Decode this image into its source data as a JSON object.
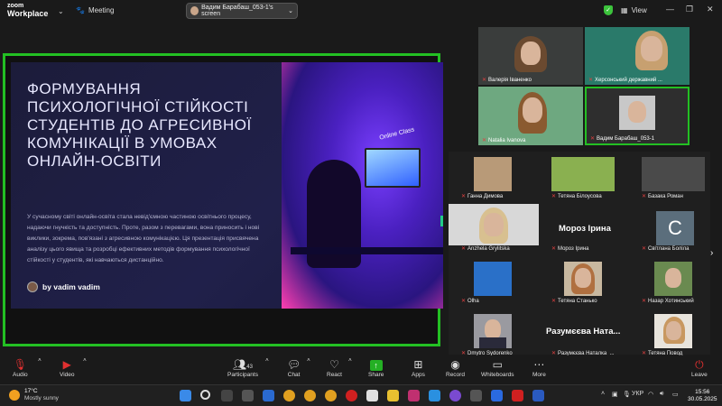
{
  "app": {
    "brand_top": "zoom",
    "brand_bottom": "Workplace",
    "meeting_label": "Meeting",
    "view_label": "View"
  },
  "share_pill": {
    "label": "Вадим Барабаш_053-1's screen"
  },
  "slide": {
    "title": "ФОРМУВАННЯ ПСИХОЛОГІЧНОЇ СТІЙКОСТІ СТУДЕНТІВ ДО АГРЕСИВНОЇ КОМУНІКАЦІЇ В УМОВАХ ОНЛАЙН-ОСВІТИ",
    "body": "У сучасному світі онлайн-освіта стала невід'ємною частиною освітнього процесу, надаючи гнучкість та доступність. Проте, разом з перевагами, вона приносить і нові виклики, зокрема, пов'язані з агресивною комунікацією. Ця презентація присвячена аналізу цього явища та розробці ефективних методів формування психологічної стійкості у студентів, які навчаються дистанційно.",
    "author": "by vadim vadim",
    "image_caption": "Online Class"
  },
  "top_tiles": [
    {
      "name": "Валерія Іваненко"
    },
    {
      "name": "Херсонський державний ..."
    },
    {
      "name": "Natalia Ivanova"
    },
    {
      "name": "Вадим Барабаш_053-1"
    }
  ],
  "bottom_tiles": [
    {
      "name": "Ганна Димова"
    },
    {
      "name": "Тетяна Білоусова"
    },
    {
      "name": "Базака Роман"
    },
    {
      "name": "Anzhela Grylitska"
    },
    {
      "name": "Мороз Ірина",
      "big": "Мороз Ірина"
    },
    {
      "name": "Світлана Болілa",
      "initial": "С"
    },
    {
      "name": "Olha"
    },
    {
      "name": "Тетяна Станько"
    },
    {
      "name": "Назар Хотинський"
    },
    {
      "name": "Dmytro Sydorenko"
    },
    {
      "name": "Разумєєва Наталка_...",
      "big": "Разумєєва Ната..."
    },
    {
      "name": "Тетяна Повод"
    }
  ],
  "toolbar": {
    "audio": "Audio",
    "video": "Video",
    "participants": "Participants",
    "participants_count": "43",
    "chat": "Chat",
    "react": "React",
    "share": "Share",
    "apps": "Apps",
    "record": "Record",
    "whiteboards": "Whiteboards",
    "more": "More",
    "leave": "Leave"
  },
  "taskbar": {
    "temp": "17°C",
    "weather": "Mostly sunny",
    "lang": "УКР",
    "time": "15:56",
    "date": "30.05.2025"
  },
  "colors": {
    "share_border": "#23c023",
    "share_button": "#24b024",
    "muted": "#e03030"
  }
}
